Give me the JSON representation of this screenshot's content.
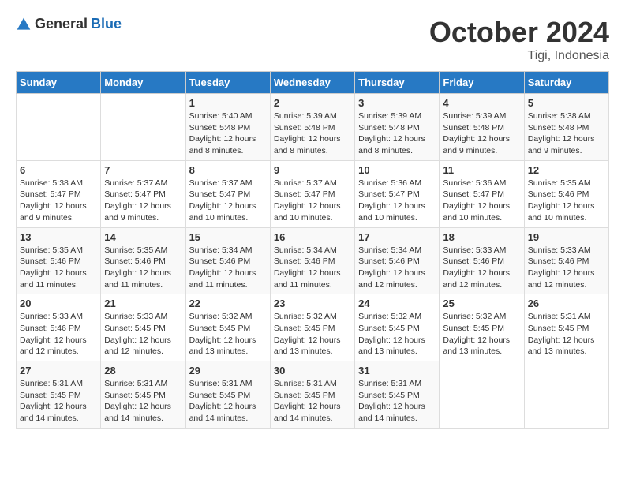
{
  "header": {
    "logo_general": "General",
    "logo_blue": "Blue",
    "month_year": "October 2024",
    "location": "Tigi, Indonesia"
  },
  "days_of_week": [
    "Sunday",
    "Monday",
    "Tuesday",
    "Wednesday",
    "Thursday",
    "Friday",
    "Saturday"
  ],
  "weeks": [
    [
      {
        "day": "",
        "sunrise": "",
        "sunset": "",
        "daylight": ""
      },
      {
        "day": "",
        "sunrise": "",
        "sunset": "",
        "daylight": ""
      },
      {
        "day": "1",
        "sunrise": "Sunrise: 5:40 AM",
        "sunset": "Sunset: 5:48 PM",
        "daylight": "Daylight: 12 hours and 8 minutes."
      },
      {
        "day": "2",
        "sunrise": "Sunrise: 5:39 AM",
        "sunset": "Sunset: 5:48 PM",
        "daylight": "Daylight: 12 hours and 8 minutes."
      },
      {
        "day": "3",
        "sunrise": "Sunrise: 5:39 AM",
        "sunset": "Sunset: 5:48 PM",
        "daylight": "Daylight: 12 hours and 8 minutes."
      },
      {
        "day": "4",
        "sunrise": "Sunrise: 5:39 AM",
        "sunset": "Sunset: 5:48 PM",
        "daylight": "Daylight: 12 hours and 9 minutes."
      },
      {
        "day": "5",
        "sunrise": "Sunrise: 5:38 AM",
        "sunset": "Sunset: 5:48 PM",
        "daylight": "Daylight: 12 hours and 9 minutes."
      }
    ],
    [
      {
        "day": "6",
        "sunrise": "Sunrise: 5:38 AM",
        "sunset": "Sunset: 5:47 PM",
        "daylight": "Daylight: 12 hours and 9 minutes."
      },
      {
        "day": "7",
        "sunrise": "Sunrise: 5:37 AM",
        "sunset": "Sunset: 5:47 PM",
        "daylight": "Daylight: 12 hours and 9 minutes."
      },
      {
        "day": "8",
        "sunrise": "Sunrise: 5:37 AM",
        "sunset": "Sunset: 5:47 PM",
        "daylight": "Daylight: 12 hours and 10 minutes."
      },
      {
        "day": "9",
        "sunrise": "Sunrise: 5:37 AM",
        "sunset": "Sunset: 5:47 PM",
        "daylight": "Daylight: 12 hours and 10 minutes."
      },
      {
        "day": "10",
        "sunrise": "Sunrise: 5:36 AM",
        "sunset": "Sunset: 5:47 PM",
        "daylight": "Daylight: 12 hours and 10 minutes."
      },
      {
        "day": "11",
        "sunrise": "Sunrise: 5:36 AM",
        "sunset": "Sunset: 5:47 PM",
        "daylight": "Daylight: 12 hours and 10 minutes."
      },
      {
        "day": "12",
        "sunrise": "Sunrise: 5:35 AM",
        "sunset": "Sunset: 5:46 PM",
        "daylight": "Daylight: 12 hours and 10 minutes."
      }
    ],
    [
      {
        "day": "13",
        "sunrise": "Sunrise: 5:35 AM",
        "sunset": "Sunset: 5:46 PM",
        "daylight": "Daylight: 12 hours and 11 minutes."
      },
      {
        "day": "14",
        "sunrise": "Sunrise: 5:35 AM",
        "sunset": "Sunset: 5:46 PM",
        "daylight": "Daylight: 12 hours and 11 minutes."
      },
      {
        "day": "15",
        "sunrise": "Sunrise: 5:34 AM",
        "sunset": "Sunset: 5:46 PM",
        "daylight": "Daylight: 12 hours and 11 minutes."
      },
      {
        "day": "16",
        "sunrise": "Sunrise: 5:34 AM",
        "sunset": "Sunset: 5:46 PM",
        "daylight": "Daylight: 12 hours and 11 minutes."
      },
      {
        "day": "17",
        "sunrise": "Sunrise: 5:34 AM",
        "sunset": "Sunset: 5:46 PM",
        "daylight": "Daylight: 12 hours and 12 minutes."
      },
      {
        "day": "18",
        "sunrise": "Sunrise: 5:33 AM",
        "sunset": "Sunset: 5:46 PM",
        "daylight": "Daylight: 12 hours and 12 minutes."
      },
      {
        "day": "19",
        "sunrise": "Sunrise: 5:33 AM",
        "sunset": "Sunset: 5:46 PM",
        "daylight": "Daylight: 12 hours and 12 minutes."
      }
    ],
    [
      {
        "day": "20",
        "sunrise": "Sunrise: 5:33 AM",
        "sunset": "Sunset: 5:46 PM",
        "daylight": "Daylight: 12 hours and 12 minutes."
      },
      {
        "day": "21",
        "sunrise": "Sunrise: 5:33 AM",
        "sunset": "Sunset: 5:45 PM",
        "daylight": "Daylight: 12 hours and 12 minutes."
      },
      {
        "day": "22",
        "sunrise": "Sunrise: 5:32 AM",
        "sunset": "Sunset: 5:45 PM",
        "daylight": "Daylight: 12 hours and 13 minutes."
      },
      {
        "day": "23",
        "sunrise": "Sunrise: 5:32 AM",
        "sunset": "Sunset: 5:45 PM",
        "daylight": "Daylight: 12 hours and 13 minutes."
      },
      {
        "day": "24",
        "sunrise": "Sunrise: 5:32 AM",
        "sunset": "Sunset: 5:45 PM",
        "daylight": "Daylight: 12 hours and 13 minutes."
      },
      {
        "day": "25",
        "sunrise": "Sunrise: 5:32 AM",
        "sunset": "Sunset: 5:45 PM",
        "daylight": "Daylight: 12 hours and 13 minutes."
      },
      {
        "day": "26",
        "sunrise": "Sunrise: 5:31 AM",
        "sunset": "Sunset: 5:45 PM",
        "daylight": "Daylight: 12 hours and 13 minutes."
      }
    ],
    [
      {
        "day": "27",
        "sunrise": "Sunrise: 5:31 AM",
        "sunset": "Sunset: 5:45 PM",
        "daylight": "Daylight: 12 hours and 14 minutes."
      },
      {
        "day": "28",
        "sunrise": "Sunrise: 5:31 AM",
        "sunset": "Sunset: 5:45 PM",
        "daylight": "Daylight: 12 hours and 14 minutes."
      },
      {
        "day": "29",
        "sunrise": "Sunrise: 5:31 AM",
        "sunset": "Sunset: 5:45 PM",
        "daylight": "Daylight: 12 hours and 14 minutes."
      },
      {
        "day": "30",
        "sunrise": "Sunrise: 5:31 AM",
        "sunset": "Sunset: 5:45 PM",
        "daylight": "Daylight: 12 hours and 14 minutes."
      },
      {
        "day": "31",
        "sunrise": "Sunrise: 5:31 AM",
        "sunset": "Sunset: 5:45 PM",
        "daylight": "Daylight: 12 hours and 14 minutes."
      },
      {
        "day": "",
        "sunrise": "",
        "sunset": "",
        "daylight": ""
      },
      {
        "day": "",
        "sunrise": "",
        "sunset": "",
        "daylight": ""
      }
    ]
  ]
}
